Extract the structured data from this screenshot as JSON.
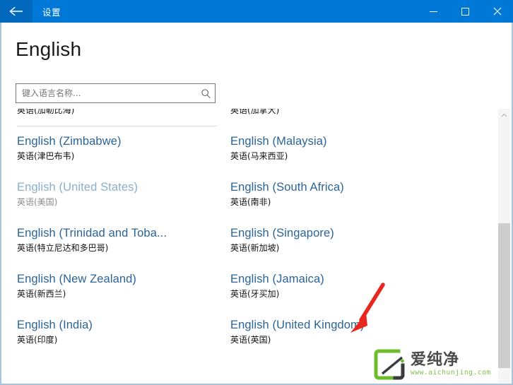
{
  "window": {
    "title": "设置",
    "back_icon": "back-arrow-icon",
    "minimize_label": "",
    "maximize_label": "",
    "close_label": "",
    "accent_color": "#0078d7",
    "back_button_color": "#0069bd",
    "border_color": "#a8c4dd"
  },
  "page": {
    "heading": "English"
  },
  "search": {
    "value": "",
    "placeholder": "键入语言名称...",
    "icon": "search-icon"
  },
  "list": {
    "clipped_top_row": {
      "left_sub": "英语(加勒比海)",
      "right_sub": "英语(加拿大)"
    },
    "rows": [
      {
        "left": {
          "name": "English (Zimbabwe)",
          "sub": "英语(津巴布韦)",
          "disabled": false
        },
        "right": {
          "name": "English (Malaysia)",
          "sub": "英语(马来西亚)",
          "disabled": false
        }
      },
      {
        "left": {
          "name": "English (United States)",
          "sub": "英语(美国)",
          "disabled": true
        },
        "right": {
          "name": "English (South Africa)",
          "sub": "英语(南非)",
          "disabled": false
        }
      },
      {
        "left": {
          "name": "English (Trinidad and Toba...",
          "sub": "英语(特立尼达和多巴哥)",
          "disabled": false
        },
        "right": {
          "name": "English (Singapore)",
          "sub": "英语(新加坡)",
          "disabled": false
        }
      },
      {
        "left": {
          "name": "English (New Zealand)",
          "sub": "英语(新西兰)",
          "disabled": false
        },
        "right": {
          "name": "English (Jamaica)",
          "sub": "英语(牙买加)",
          "disabled": false
        }
      },
      {
        "left": {
          "name": "English (India)",
          "sub": "英语(印度)",
          "disabled": false
        },
        "right": {
          "name": "English (United Kingdom)",
          "sub": "英语(英国)",
          "disabled": false
        }
      }
    ]
  },
  "scrollbar": {
    "up_arrow_icon": "chevron-up-icon",
    "thumb_color": "#cdcdcd",
    "track_color": "#f5f5f5"
  },
  "annotation": {
    "arrow_color": "#e8281e",
    "points_to": "English (United Kingdom)"
  },
  "watermark": {
    "brand": "爱纯净",
    "url": "www.aichunjing.com",
    "logo_color": "#6dbd2a"
  },
  "colors": {
    "link": "#2a6496",
    "link_disabled": "#8aafcc",
    "sub_text": "#111111",
    "sub_text_disabled": "#8d8d8d"
  }
}
